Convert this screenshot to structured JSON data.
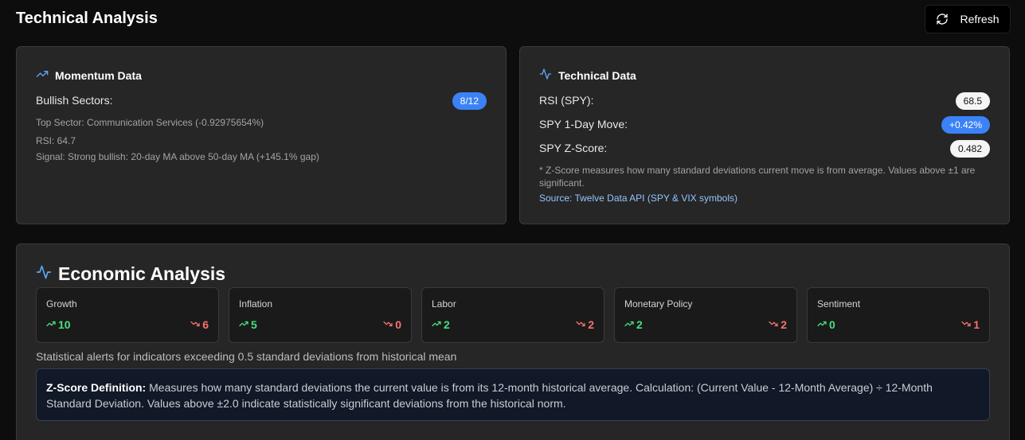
{
  "header": {
    "title": "Technical Analysis",
    "refresh_label": "Refresh"
  },
  "momentum": {
    "title": "Momentum Data",
    "bullish_label": "Bullish Sectors:",
    "bullish_value": "8/12",
    "top_sector": "Top Sector: Communication Services (-0.92975654%)",
    "rsi": "RSI: 64.7",
    "signal": "Signal: Strong bullish: 20-day MA above 50-day MA (+145.1% gap)"
  },
  "technical": {
    "title": "Technical Data",
    "rows": [
      {
        "label": "RSI (SPY):",
        "value": "68.5"
      },
      {
        "label": "SPY 1-Day Move:",
        "value": "+0.42%"
      },
      {
        "label": "SPY Z-Score:",
        "value": "0.482"
      }
    ],
    "note": "* Z-Score measures how many standard deviations current move is from average. Values above ±1 are significant.",
    "source": "Source: Twelve Data API (SPY & VIX symbols)"
  },
  "economic": {
    "title": "Economic Analysis",
    "metrics": [
      {
        "name": "Growth",
        "up": "10",
        "down": "6"
      },
      {
        "name": "Inflation",
        "up": "5",
        "down": "0"
      },
      {
        "name": "Labor",
        "up": "2",
        "down": "2"
      },
      {
        "name": "Monetary Policy",
        "up": "2",
        "down": "2"
      },
      {
        "name": "Sentiment",
        "up": "0",
        "down": "1"
      }
    ],
    "alert_text": "Statistical alerts for indicators exceeding 0.5 standard deviations from historical mean",
    "zscore_title": "Z-Score Definition:",
    "zscore_body": " Measures how many standard deviations the current value is from its 12-month historical average. Calculation: (Current Value - 12-Month Average) ÷ 12-Month Standard Deviation. Values above ±2.0 indicate statistically significant deviations from the historical norm."
  },
  "colors": {
    "accent_blue": "#3b82f6",
    "positive": "#4ade80",
    "negative": "#f87171",
    "link": "#93c5fd"
  },
  "icons": {
    "refresh": "refresh-icon",
    "momentum": "trending-up-icon",
    "technical": "activity-icon",
    "economic": "activity-icon",
    "up": "trend-up-icon",
    "down": "trend-down-icon"
  }
}
